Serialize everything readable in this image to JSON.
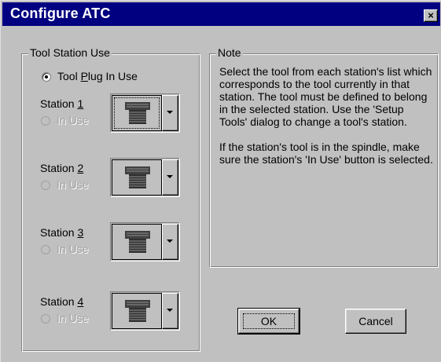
{
  "window": {
    "title": "Configure ATC",
    "close_icon": "close-icon",
    "close_glyph": "×"
  },
  "tool_station_group": {
    "label": "Tool Station Use",
    "plug_option": {
      "label_before": "Tool ",
      "label_mnemonic": "P",
      "label_after": "lug In Use",
      "checked": true
    },
    "stations": [
      {
        "label_before": "Station ",
        "mnemonic": "1",
        "in_use_label": "In Use",
        "in_use_enabled": false,
        "tool_icon": "tool-holder-icon",
        "focused": true
      },
      {
        "label_before": "Station ",
        "mnemonic": "2",
        "in_use_label": "In Use",
        "in_use_enabled": false,
        "tool_icon": "tool-holder-icon",
        "focused": false
      },
      {
        "label_before": "Station ",
        "mnemonic": "3",
        "in_use_label": "In Use",
        "in_use_enabled": false,
        "tool_icon": "tool-holder-icon",
        "focused": false
      },
      {
        "label_before": "Station ",
        "mnemonic": "4",
        "in_use_label": "In Use",
        "in_use_enabled": false,
        "tool_icon": "tool-holder-icon",
        "focused": false
      }
    ]
  },
  "note_group": {
    "label": "Note",
    "paragraph1": "Select the tool from each station's list which corresponds to the tool currently in that station.  The tool must be defined to belong in the selected station.   Use the 'Setup Tools' dialog to change a tool's station.",
    "paragraph2": "If the station's tool is in the spindle, make sure the station's 'In Use' button is selected."
  },
  "buttons": {
    "ok_label": "OK",
    "cancel_label": "Cancel"
  },
  "colors": {
    "titlebar": "#000080",
    "face": "#c0c0c0",
    "disabled_text": "#a0a0a0"
  }
}
